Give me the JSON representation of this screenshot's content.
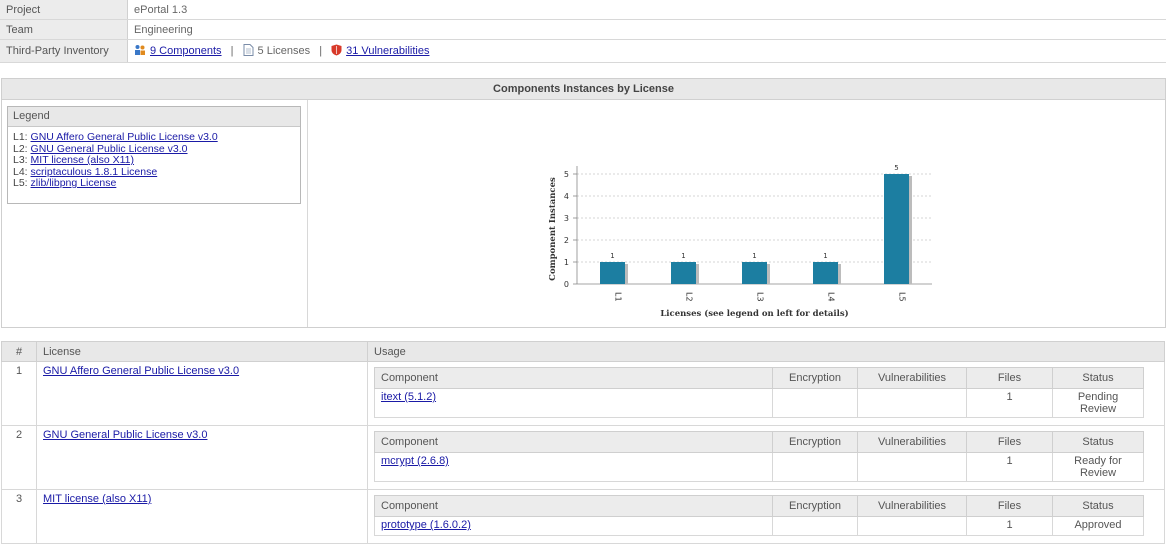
{
  "info": {
    "project_label": "Project",
    "project_value": "ePortal 1.3",
    "team_label": "Team",
    "team_value": "Engineering",
    "inventory_label": "Third-Party Inventory",
    "components_link": "9 Components",
    "licenses_text": "5 Licenses",
    "vulnerabilities_link": "31 Vulnerabilities",
    "separator": "|"
  },
  "panel": {
    "title": "Components Instances by License",
    "legend_title": "Legend",
    "legend_items": [
      {
        "key": "L1:",
        "name": "GNU Affero General Public License v3.0"
      },
      {
        "key": "L2:",
        "name": "GNU General Public License v3.0"
      },
      {
        "key": "L3:",
        "name": "MIT license (also X11)"
      },
      {
        "key": "L4:",
        "name": "scriptaculous 1.8.1 License"
      },
      {
        "key": "L5:",
        "name": "zlib/libpng License"
      }
    ]
  },
  "chart_data": {
    "type": "bar",
    "categories": [
      "L1",
      "L2",
      "L3",
      "L4",
      "L5"
    ],
    "values": [
      1,
      1,
      1,
      1,
      5
    ],
    "xlabel": "Licenses (see legend on left for details)",
    "ylabel": "Component Instances",
    "ylim": [
      0,
      5
    ],
    "yticks": [
      0,
      1,
      2,
      3,
      4,
      5
    ],
    "grid": true,
    "bar_color": "#1c7ea1"
  },
  "licenses_table": {
    "headers": {
      "num": "#",
      "license": "License",
      "usage": "Usage"
    },
    "usage_headers": {
      "component": "Component",
      "encryption": "Encryption",
      "vulnerabilities": "Vulnerabilities",
      "files": "Files",
      "status": "Status"
    },
    "rows": [
      {
        "num": "1",
        "license": "GNU Affero General Public License v3.0",
        "component": "itext (5.1.2)",
        "encryption": "",
        "vulnerabilities": "",
        "files": "1",
        "status": "Pending Review"
      },
      {
        "num": "2",
        "license": "GNU General Public License v3.0",
        "component": "mcrypt (2.6.8)",
        "encryption": "",
        "vulnerabilities": "",
        "files": "1",
        "status": "Ready for Review"
      },
      {
        "num": "3",
        "license": "MIT license (also X11)",
        "component": "prototype (1.6.0.2)",
        "encryption": "",
        "vulnerabilities": "",
        "files": "1",
        "status": "Approved"
      }
    ]
  }
}
